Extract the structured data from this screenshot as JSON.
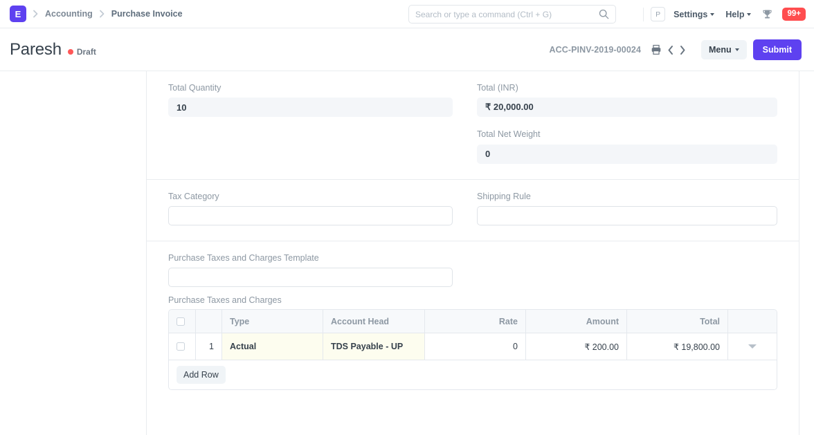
{
  "navbar": {
    "logo_text": "E",
    "logo_color": "#5e41f0",
    "breadcrumbs": [
      {
        "label": "Accounting"
      },
      {
        "label": "Purchase Invoice"
      }
    ],
    "search": {
      "placeholder": "Search or type a command (Ctrl + G)",
      "value": "",
      "icon": "search-icon"
    },
    "avatar_initial": "P",
    "settings_label": "Settings",
    "help_label": "Help",
    "trophy_icon": "trophy-icon",
    "notification_count": "99+",
    "notification_color": "#ff4d4f"
  },
  "page_head": {
    "title": "Paresh",
    "status": "Draft",
    "status_color": "#ff5858",
    "doc_id": "ACC-PINV-2019-00024",
    "print_icon": "print-icon",
    "prev_icon": "chevron-left-icon",
    "next_icon": "chevron-right-icon",
    "menu_label": "Menu",
    "submit_label": "Submit",
    "submit_color": "#5e41f0"
  },
  "totals_section": {
    "total_quantity": {
      "label": "Total Quantity",
      "value": "10"
    },
    "total_inr": {
      "label": "Total (INR)",
      "value": "₹ 20,000.00"
    },
    "total_net_weight": {
      "label": "Total Net Weight",
      "value": "0"
    }
  },
  "tax_section": {
    "tax_category": {
      "label": "Tax Category",
      "value": "",
      "placeholder": ""
    },
    "shipping_rule": {
      "label": "Shipping Rule",
      "value": "",
      "placeholder": ""
    }
  },
  "charges_section": {
    "template": {
      "label": "Purchase Taxes and Charges Template",
      "value": "",
      "placeholder": ""
    },
    "grid_label": "Purchase Taxes and Charges",
    "columns": [
      {
        "key": "check",
        "label": ""
      },
      {
        "key": "idx",
        "label": ""
      },
      {
        "key": "type",
        "label": "Type"
      },
      {
        "key": "account_head",
        "label": "Account Head"
      },
      {
        "key": "rate",
        "label": "Rate"
      },
      {
        "key": "amount",
        "label": "Amount"
      },
      {
        "key": "total",
        "label": "Total"
      },
      {
        "key": "expand",
        "label": ""
      }
    ],
    "rows": [
      {
        "idx": "1",
        "type": "Actual",
        "account_head": "TDS Payable - UP",
        "rate": "0",
        "amount": "₹ 200.00",
        "total": "₹ 19,800.00"
      }
    ],
    "add_row_label": "Add Row"
  }
}
